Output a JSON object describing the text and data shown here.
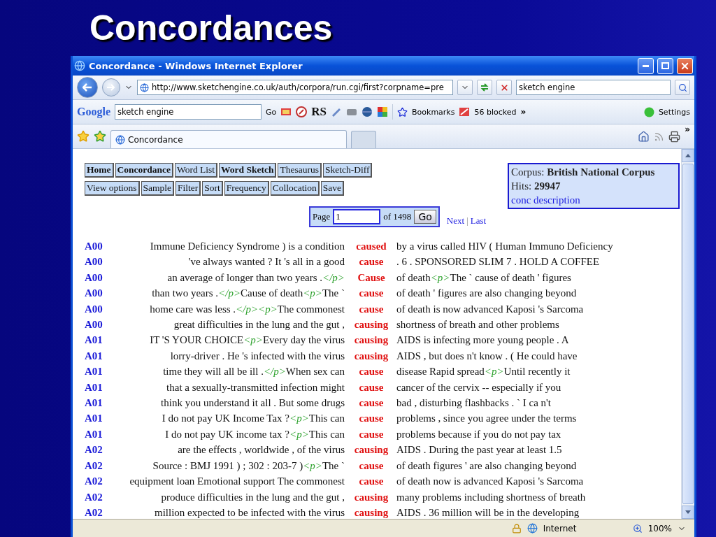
{
  "slide": {
    "title": "Concordances"
  },
  "window": {
    "title": "Concordance - Windows Internet Explorer"
  },
  "address_bar": {
    "url": "http://www.sketchengine.co.uk/auth/corpora/run.cgi/first?corpname=pre",
    "search_value": "sketch engine"
  },
  "google_toolbar": {
    "logo": "Google",
    "search_value": "sketch engine",
    "go": "Go",
    "rs": "RS",
    "bookmarks": "Bookmarks",
    "blocked": "56 blocked",
    "more": "»",
    "settings": "Settings"
  },
  "tab_bar": {
    "tabs": [
      {
        "label": "Concordance",
        "selected": true
      }
    ],
    "more": "»"
  },
  "nav_rows": [
    [
      {
        "label": "Home",
        "bold": true
      },
      {
        "label": "Concordance",
        "bold": true
      },
      {
        "label": "Word List",
        "bold": false
      },
      {
        "label": "Word Sketch",
        "bold": true
      },
      {
        "label": "Thesaurus",
        "bold": false
      },
      {
        "label": "Sketch-Diff",
        "bold": false
      }
    ],
    [
      {
        "label": "View options",
        "bold": false
      },
      {
        "label": "Sample",
        "bold": false
      },
      {
        "label": "Filter",
        "bold": false
      },
      {
        "label": "Sort",
        "bold": false
      },
      {
        "label": "Frequency",
        "bold": false
      },
      {
        "label": "Collocation",
        "bold": false
      },
      {
        "label": "Save",
        "bold": false
      }
    ]
  ],
  "corpus_box": {
    "corpus_label": "Corpus:",
    "corpus": "British National Corpus",
    "hits_label": "Hits:",
    "hits": "29947",
    "link": "conc description"
  },
  "pager": {
    "page_label": "Page",
    "page": "1",
    "of": "of 1498",
    "go": "Go",
    "next": "Next",
    "separator": "|",
    "last": "Last"
  },
  "lines": [
    {
      "ref": "A00",
      "left": [
        {
          "kind": "text",
          "text": "Immune Deficiency Syndrome ) is a condition"
        }
      ],
      "kwic": "caused",
      "right": [
        {
          "kind": "text",
          "text": "by a virus called HIV ( Human Immuno Deficiency"
        }
      ]
    },
    {
      "ref": "A00",
      "left": [
        {
          "kind": "text",
          "text": "'ve always wanted ? It 's all in a good"
        }
      ],
      "kwic": "cause",
      "right": [
        {
          "kind": "text",
          "text": ". 6 . SPONSORED SLIM 7 . HOLD A COFFEE"
        }
      ]
    },
    {
      "ref": "A00",
      "left": [
        {
          "kind": "text",
          "text": "an average of longer than two years ."
        },
        {
          "kind": "tag",
          "text": "</p>"
        }
      ],
      "kwic": "Cause",
      "right": [
        {
          "kind": "text",
          "text": "of death"
        },
        {
          "kind": "tag",
          "text": "<p>"
        },
        {
          "kind": "text",
          "text": "The ` cause of death ' figures"
        }
      ]
    },
    {
      "ref": "A00",
      "left": [
        {
          "kind": "text",
          "text": "than two years ."
        },
        {
          "kind": "tag",
          "text": "</p>"
        },
        {
          "kind": "text",
          "text": "Cause of death"
        },
        {
          "kind": "tag",
          "text": "<p>"
        },
        {
          "kind": "text",
          "text": "The `"
        }
      ],
      "kwic": "cause",
      "right": [
        {
          "kind": "text",
          "text": "of death ' figures are also changing beyond"
        }
      ]
    },
    {
      "ref": "A00",
      "left": [
        {
          "kind": "text",
          "text": "home care was less ."
        },
        {
          "kind": "tag",
          "text": "</p><p>"
        },
        {
          "kind": "text",
          "text": "The commonest"
        }
      ],
      "kwic": "cause",
      "right": [
        {
          "kind": "text",
          "text": "of death is now advanced Kaposi 's Sarcoma"
        }
      ]
    },
    {
      "ref": "A00",
      "left": [
        {
          "kind": "text",
          "text": "great difficulties in the lung and the gut ,"
        }
      ],
      "kwic": "causing",
      "right": [
        {
          "kind": "text",
          "text": "shortness of breath and other problems"
        }
      ]
    },
    {
      "ref": "A01",
      "left": [
        {
          "kind": "text",
          "text": "IT 'S YOUR CHOICE"
        },
        {
          "kind": "tag",
          "text": "<p>"
        },
        {
          "kind": "text",
          "text": "Every day the virus"
        }
      ],
      "kwic": "causing",
      "right": [
        {
          "kind": "text",
          "text": "AIDS is infecting more young people . A"
        }
      ]
    },
    {
      "ref": "A01",
      "left": [
        {
          "kind": "text",
          "text": "lorry-driver . He 's infected with the virus"
        }
      ],
      "kwic": "causing",
      "right": [
        {
          "kind": "text",
          "text": "AIDS , but does n't know . ( He could have"
        }
      ]
    },
    {
      "ref": "A01",
      "left": [
        {
          "kind": "text",
          "text": "time they will all be ill ."
        },
        {
          "kind": "tag",
          "text": "</p>"
        },
        {
          "kind": "text",
          "text": "When sex can"
        }
      ],
      "kwic": "cause",
      "right": [
        {
          "kind": "text",
          "text": "disease Rapid spread"
        },
        {
          "kind": "tag",
          "text": "<p>"
        },
        {
          "kind": "text",
          "text": "Until recently it"
        }
      ]
    },
    {
      "ref": "A01",
      "left": [
        {
          "kind": "text",
          "text": "that a sexually-transmitted infection might"
        }
      ],
      "kwic": "cause",
      "right": [
        {
          "kind": "text",
          "text": "cancer of the cervix -- especially if you"
        }
      ]
    },
    {
      "ref": "A01",
      "left": [
        {
          "kind": "text",
          "text": "think you understand it all . But some drugs"
        }
      ],
      "kwic": "cause",
      "right": [
        {
          "kind": "text",
          "text": "bad , disturbing flashbacks . ` I ca n't"
        }
      ]
    },
    {
      "ref": "A01",
      "left": [
        {
          "kind": "text",
          "text": "I do not pay UK Income Tax ?"
        },
        {
          "kind": "tag",
          "text": "<p>"
        },
        {
          "kind": "text",
          "text": "This can"
        }
      ],
      "kwic": "cause",
      "right": [
        {
          "kind": "text",
          "text": "problems , since you agree under the terms"
        }
      ]
    },
    {
      "ref": "A01",
      "left": [
        {
          "kind": "text",
          "text": "I do not pay UK income tax ?"
        },
        {
          "kind": "tag",
          "text": "<p>"
        },
        {
          "kind": "text",
          "text": "This can"
        }
      ],
      "kwic": "cause",
      "right": [
        {
          "kind": "text",
          "text": "problems because if you do not pay tax"
        }
      ]
    },
    {
      "ref": "A02",
      "left": [
        {
          "kind": "text",
          "text": "are the effects , worldwide , of the virus"
        }
      ],
      "kwic": "causing",
      "right": [
        {
          "kind": "text",
          "text": "AIDS . During the past year at least 1.5"
        }
      ]
    },
    {
      "ref": "A02",
      "left": [
        {
          "kind": "text",
          "text": "Source : BMJ 1991 ) ; 302 : 203-7 )"
        },
        {
          "kind": "tag",
          "text": "<p>"
        },
        {
          "kind": "text",
          "text": "The `"
        }
      ],
      "kwic": "cause",
      "right": [
        {
          "kind": "text",
          "text": "of death figures ' are also changing beyond"
        }
      ]
    },
    {
      "ref": "A02",
      "left": [
        {
          "kind": "text",
          "text": "equipment loan Emotional support The commonest"
        }
      ],
      "kwic": "cause",
      "right": [
        {
          "kind": "text",
          "text": "of death now is advanced Kaposi 's Sarcoma"
        }
      ]
    },
    {
      "ref": "A02",
      "left": [
        {
          "kind": "text",
          "text": "produce difficulties in the lung and the gut ,"
        }
      ],
      "kwic": "causing",
      "right": [
        {
          "kind": "text",
          "text": "many problems including shortness of breath"
        }
      ]
    },
    {
      "ref": "A02",
      "left": [
        {
          "kind": "text",
          "text": "million expected to be infected with the virus"
        }
      ],
      "kwic": "causing",
      "right": [
        {
          "kind": "text",
          "text": "AIDS . 36 million will be in the developing"
        }
      ]
    }
  ],
  "status_bar": {
    "zone": "Internet",
    "zoom": "100%"
  }
}
